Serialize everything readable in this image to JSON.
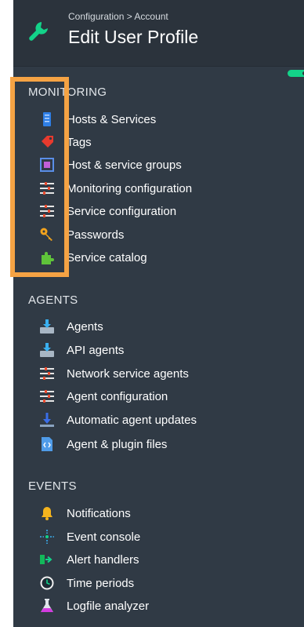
{
  "header": {
    "breadcrumb": "Configuration > Account",
    "title": "Edit User Profile"
  },
  "colors": {
    "panel_bg": "#303a45",
    "header_bg": "#2b333c",
    "toggle_accent": "#13d389",
    "highlight_border": "#f5a344"
  },
  "sections": [
    {
      "title": "MONITORING",
      "items": [
        {
          "label": "Hosts & Services",
          "icon": "server-icon"
        },
        {
          "label": "Tags",
          "icon": "tag-icon"
        },
        {
          "label": "Host & service groups",
          "icon": "groups-icon"
        },
        {
          "label": "Monitoring configuration",
          "icon": "rules-icon"
        },
        {
          "label": "Service configuration",
          "icon": "rules-icon"
        },
        {
          "label": "Passwords",
          "icon": "key-icon"
        },
        {
          "label": "Service catalog",
          "icon": "puzzle-icon"
        }
      ]
    },
    {
      "title": "AGENTS",
      "items": [
        {
          "label": "Agents",
          "icon": "download-icon"
        },
        {
          "label": "API agents",
          "icon": "download-icon"
        },
        {
          "label": "Network service agents",
          "icon": "rules-icon"
        },
        {
          "label": "Agent configuration",
          "icon": "rules-icon"
        },
        {
          "label": "Automatic agent updates",
          "icon": "update-icon"
        },
        {
          "label": "Agent & plugin files",
          "icon": "file-code-icon"
        }
      ]
    },
    {
      "title": "EVENTS",
      "items": [
        {
          "label": "Notifications",
          "icon": "bell-icon"
        },
        {
          "label": "Event console",
          "icon": "event-console-icon"
        },
        {
          "label": "Alert handlers",
          "icon": "alert-handler-icon"
        },
        {
          "label": "Time periods",
          "icon": "clock-icon"
        },
        {
          "label": "Logfile analyzer",
          "icon": "flask-icon"
        }
      ]
    }
  ]
}
